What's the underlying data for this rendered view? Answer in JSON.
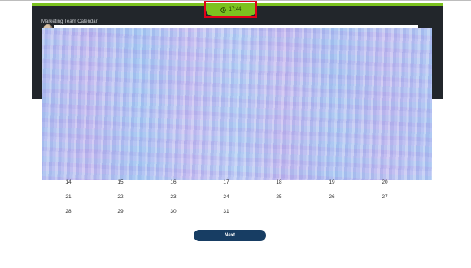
{
  "header": {
    "timer": "17:44",
    "calendar_title": "Marketing Team Calendar"
  },
  "calendar": {
    "weeks": [
      [
        "14",
        "15",
        "16",
        "17",
        "18",
        "19",
        "20"
      ],
      [
        "21",
        "22",
        "23",
        "24",
        "25",
        "26",
        "27"
      ],
      [
        "28",
        "29",
        "30",
        "31"
      ]
    ]
  },
  "footer": {
    "next_label": "Next"
  },
  "colors": {
    "accent_green": "#7cc21f",
    "dark_panel": "#22262b",
    "button_navy": "#173d63",
    "highlight_red": "#e2001a"
  },
  "icons": {
    "timer": "clock-icon",
    "user": "avatar"
  }
}
